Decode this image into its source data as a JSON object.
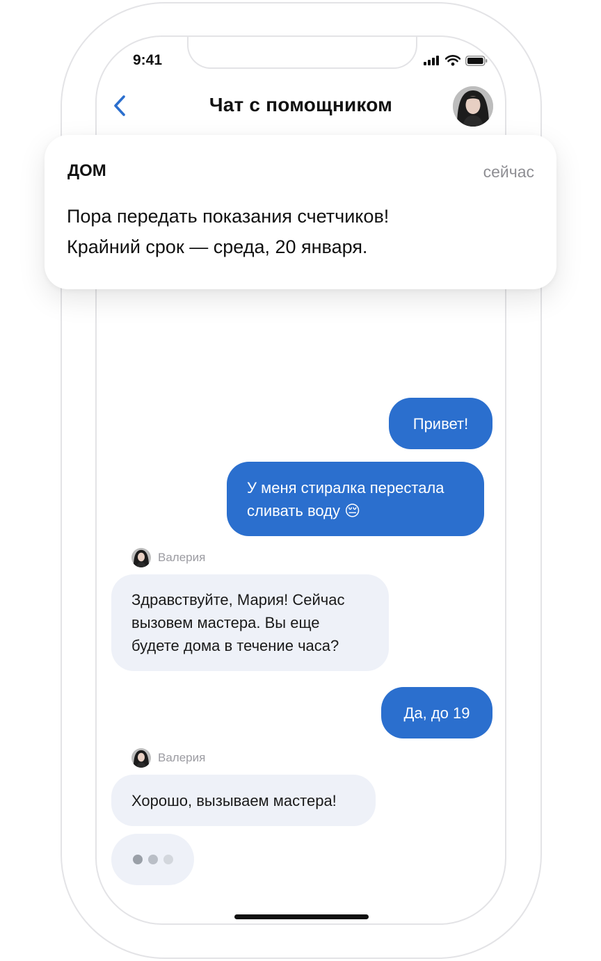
{
  "status_bar": {
    "time": "9:41"
  },
  "header": {
    "title": "Чат с помощником"
  },
  "notification": {
    "app": "ДОМ",
    "time": "сейчас",
    "body_line1": "Пора передать показания счетчиков!",
    "body_line2": "Крайний срок — среда, 20 января."
  },
  "messages": [
    {
      "direction": "out",
      "line1": "Привет!"
    },
    {
      "direction": "out",
      "line1": "У меня стиралка перестала",
      "line2": "сливать воду",
      "emoji": "😔"
    },
    {
      "direction": "in",
      "sender": "Валерия",
      "line1": "Здравствуйте, Мария! Сейчас",
      "line2": "вызовем мастера. Вы еще",
      "line3": "будете дома в течение часа?"
    },
    {
      "direction": "out",
      "line1": "Да, до 19"
    },
    {
      "direction": "in",
      "sender": "Валерия",
      "line1": "Хорошо, вызываем мастера!"
    }
  ],
  "typing_indicator": {
    "dots": 3
  },
  "colors": {
    "outgoing_bubble": "#2b6fce",
    "incoming_bubble": "#eef1f8",
    "accent": "#2b6fce",
    "frame": "#e3e3e6"
  },
  "icons": [
    "back-chevron-icon",
    "signal-icon",
    "wifi-icon",
    "battery-icon",
    "avatar"
  ]
}
